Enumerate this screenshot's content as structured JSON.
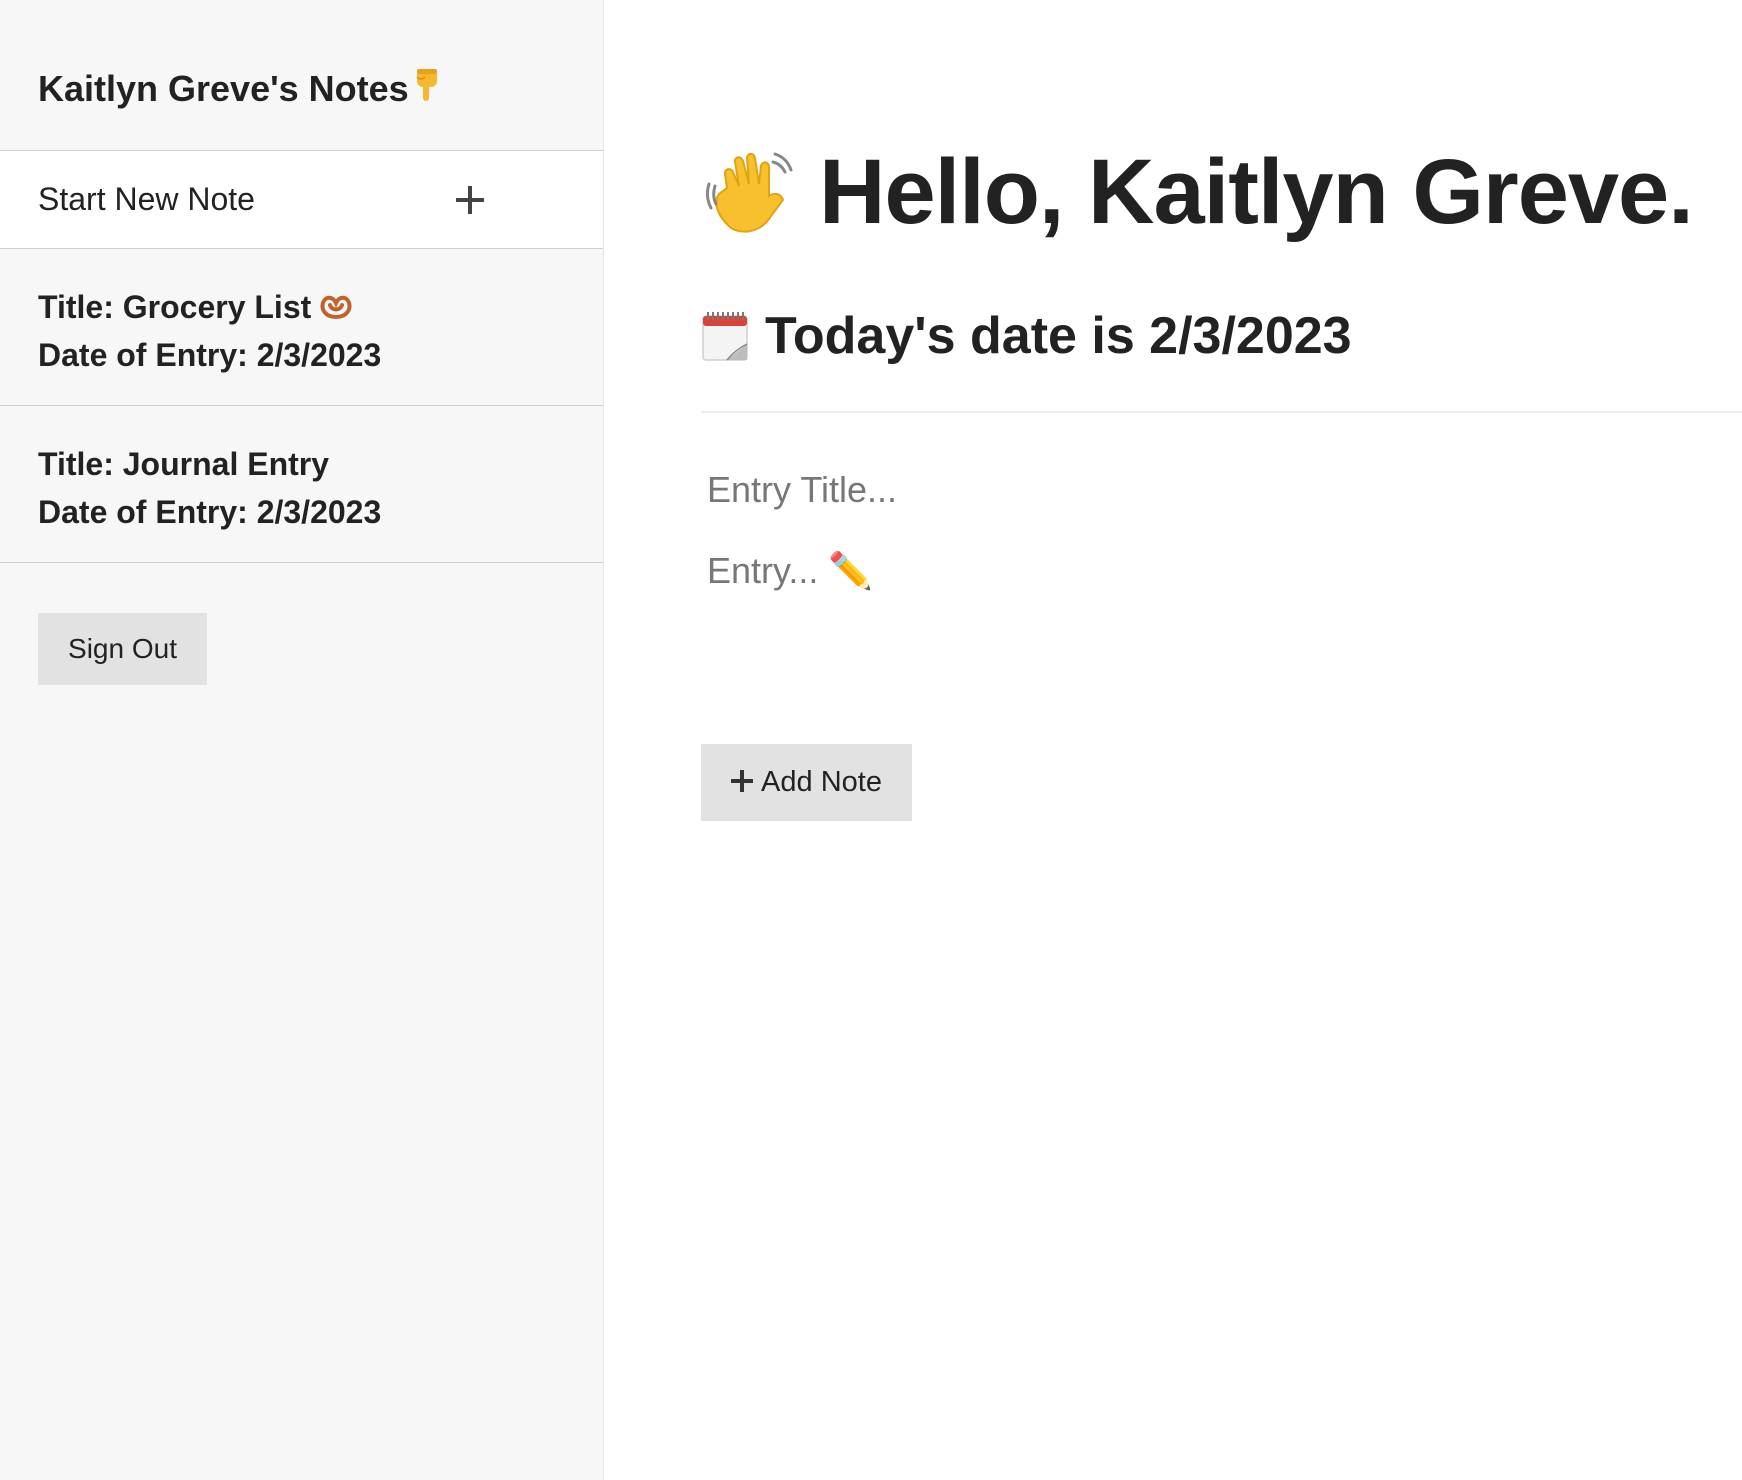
{
  "sidebar": {
    "title": "Kaitlyn Greve's Notes",
    "title_icon": "pointing-down-hand-icon",
    "new_note_label": "Start New Note",
    "new_note_icon": "plus-icon",
    "notes": [
      {
        "title_line": "Title: Grocery List",
        "title_icon": "pretzel-icon",
        "date_line": "Date of Entry: 2/3/2023"
      },
      {
        "title_line": "Title: Journal Entry",
        "date_line": "Date of Entry: 2/3/2023"
      }
    ],
    "sign_out_label": "Sign Out"
  },
  "main": {
    "greeting": "Hello, Kaitlyn Greve.",
    "greeting_icon": "waving-hand-icon",
    "date_text": "Today's date is 2/3/2023",
    "date_icon": "calendar-icon",
    "title_placeholder": "Entry Title...",
    "entry_placeholder": "Entry... ✏️",
    "add_note_label": "Add Note",
    "add_note_icon": "plus-icon"
  },
  "colors": {
    "sidebar_bg": "#f7f7f7",
    "main_bg": "#ffffff",
    "button_bg": "#e2e2e2",
    "text": "#222222",
    "placeholder": "#777777"
  }
}
